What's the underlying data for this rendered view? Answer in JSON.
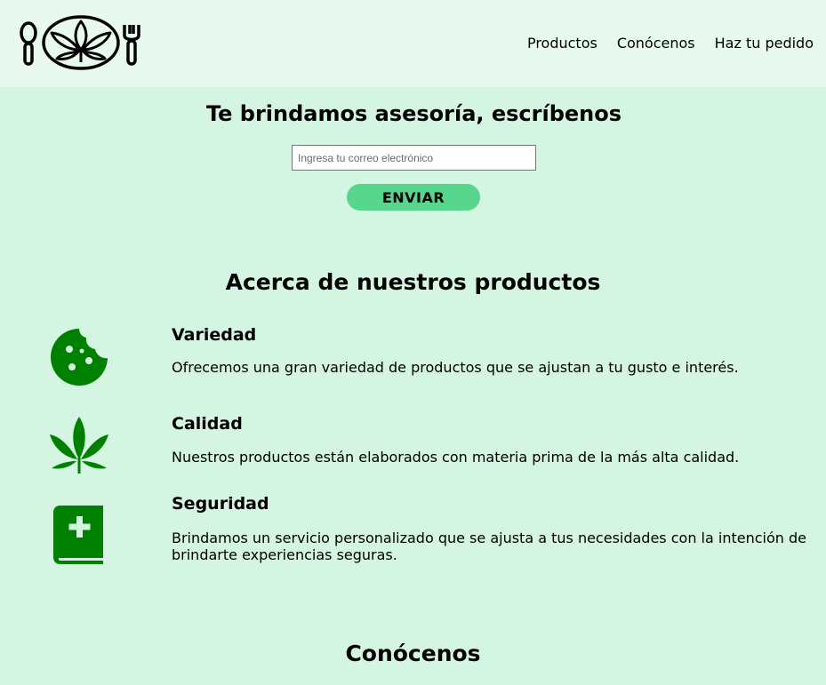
{
  "header": {
    "logo": "cannabis-kitchen-logo",
    "nav": [
      "Productos",
      "Conócenos",
      "Haz tu pedido"
    ]
  },
  "advice": {
    "title": "Te brindamos asesoría, escríbenos",
    "email_placeholder": "Ingresa tu correo electrónico",
    "email_value": "",
    "send_label": "ENVIAR"
  },
  "about": {
    "title": "Acerca de nuestros productos",
    "features": [
      {
        "icon": "cookie-icon",
        "title": "Variedad",
        "text": "Ofrecemos una gran variedad de productos que se ajustan a tu gusto e interés."
      },
      {
        "icon": "cannabis-leaf-icon",
        "title": "Calidad",
        "text": "Nuestros productos están elaborados con materia prima de la más alta calidad."
      },
      {
        "icon": "medical-book-icon",
        "title": "Seguridad",
        "text": "Brindamos un servicio personalizado que se ajusta a tus necesidades con la intención de brindarte experiencias seguras."
      }
    ]
  },
  "meet": {
    "title": "Conócenos"
  },
  "colors": {
    "page_bg": "#d4f5e2",
    "header_bg": "#e8faef",
    "button_bg": "#58d68d",
    "icon_green": "#008000"
  }
}
